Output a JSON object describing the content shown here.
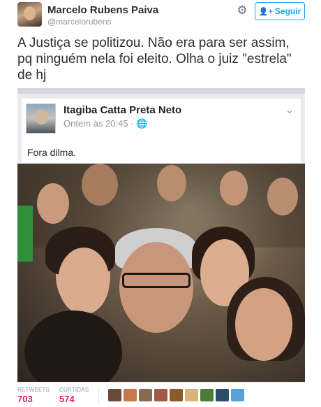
{
  "author": {
    "name": "Marcelo Rubens Paiva",
    "handle": "@marcelorubens"
  },
  "follow_button": {
    "label": "Seguir",
    "icon": "add-person-icon"
  },
  "settings": {
    "icon": "gear-icon"
  },
  "tweet": {
    "text_lines": [
      "A Justiça se politizou. Não era para ser assim,",
      "pq ninguém nela foi eleito. Olha o juiz \"estrela\"",
      "de hj"
    ]
  },
  "embedded_post": {
    "author_name": "Itagiba Catta Preta Neto",
    "time": "Ontem às 20:45",
    "separator": "·",
    "privacy_icon": "globe-icon",
    "post_text": "Fora dilma.",
    "menu_icon": "chevron-down-icon"
  },
  "stats": {
    "retweets_label": "RETWEETS",
    "retweets_value": "703",
    "likes_label": "CURTIDAS",
    "likes_value": "574"
  },
  "likers": [
    {
      "color": "#6b4a3a"
    },
    {
      "color": "#c47a4b"
    },
    {
      "color": "#8a6a55"
    },
    {
      "color": "#a35a48"
    },
    {
      "color": "#8b5a2b"
    },
    {
      "color": "#d8b47a"
    },
    {
      "color": "#4b7a3a"
    },
    {
      "color": "#2d4a6b"
    },
    {
      "color": "#5aa0d8"
    }
  ],
  "colors": {
    "accent": "#1da1f2",
    "stat_value": "#e0245e"
  }
}
